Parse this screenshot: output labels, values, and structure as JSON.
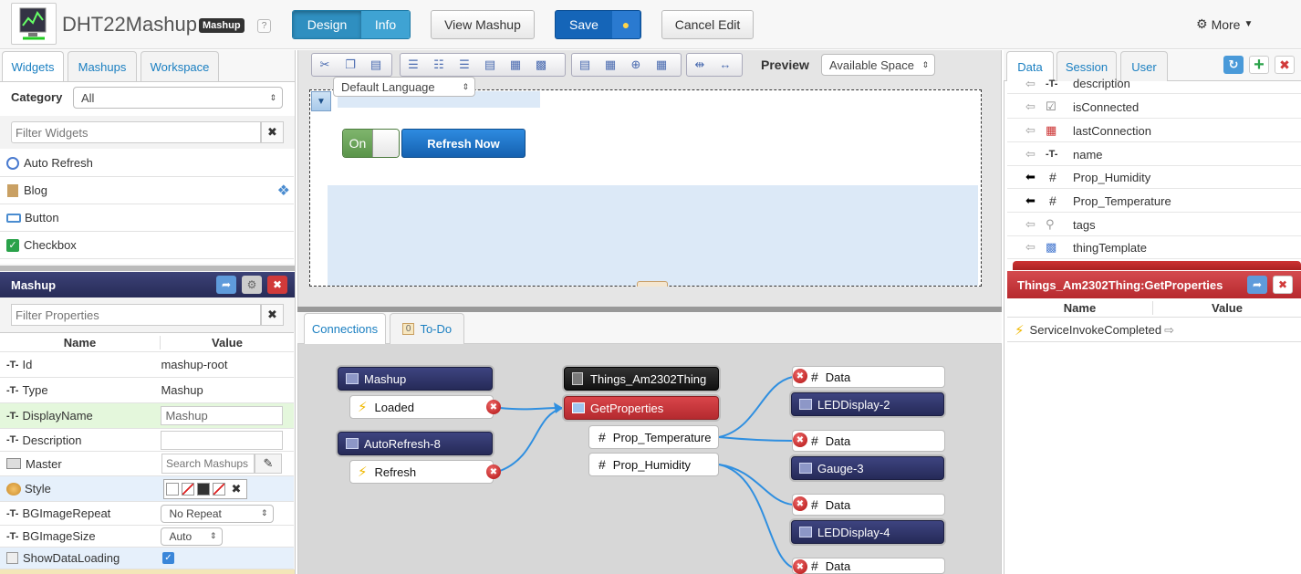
{
  "header": {
    "title": "DHT22Mashup",
    "badge": "Mashup",
    "help": "?",
    "design": "Design",
    "info": "Info",
    "view_mashup": "View Mashup",
    "save": "Save",
    "cancel_edit": "Cancel Edit",
    "more": "More"
  },
  "left_tabs": [
    "Widgets",
    "Mashups",
    "Workspace"
  ],
  "widgets": {
    "category_label": "Category",
    "category_value": "All",
    "filter_placeholder": "Filter Widgets",
    "items": [
      "Auto Refresh",
      "Blog",
      "Button",
      "Checkbox"
    ]
  },
  "mashup_panel": {
    "title": "Mashup",
    "filter_placeholder": "Filter Properties",
    "col_name": "Name",
    "col_value": "Value",
    "props": [
      {
        "name": "Id",
        "value": "mashup-root"
      },
      {
        "name": "Type",
        "value": "Mashup"
      },
      {
        "name": "DisplayName",
        "value": "Mashup"
      },
      {
        "name": "Description",
        "value": ""
      },
      {
        "name": "Master",
        "placeholder": "Search Mashups"
      },
      {
        "name": "Style"
      },
      {
        "name": "BGImageRepeat",
        "value": "No Repeat"
      },
      {
        "name": "BGImageSize",
        "value": "Auto"
      },
      {
        "name": "ShowDataLoading",
        "checked": true
      }
    ]
  },
  "canvas": {
    "preview_label": "Preview",
    "preview_value": "Available Space",
    "language": "Default Language",
    "toggle_label": "On",
    "refresh_button": "Refresh Now"
  },
  "bottom_tabs": {
    "connections": "Connections",
    "todo": "To-Do",
    "todo_count": "0"
  },
  "connections": {
    "mashup": "Mashup",
    "loaded": "Loaded",
    "autorefresh": "AutoRefresh-8",
    "refresh": "Refresh",
    "thing": "Things_Am2302Thing",
    "service": "GetProperties",
    "prop_temperature": "Prop_Temperature",
    "prop_humidity": "Prop_Humidity",
    "data_label": "Data",
    "led2": "LEDDisplay-2",
    "gauge3": "Gauge-3",
    "led4": "LEDDisplay-4"
  },
  "right_tabs": [
    "Data",
    "Session",
    "User"
  ],
  "data_items": [
    "description",
    "isConnected",
    "lastConnection",
    "name",
    "Prop_Humidity",
    "Prop_Temperature",
    "tags",
    "thingTemplate"
  ],
  "service_panel": {
    "title": "Things_Am2302Thing:GetProperties",
    "col_name": "Name",
    "col_value": "Value",
    "event": "ServiceInvokeCompleted"
  },
  "colors": {
    "accent": "#1a7fc1",
    "dark_node": "#2f346a",
    "red_node": "#c8383d",
    "save_blue": "#1565b8"
  }
}
